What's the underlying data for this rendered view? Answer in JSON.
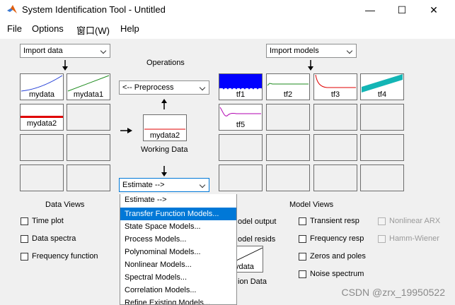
{
  "window": {
    "title": "System Identification Tool - Untitled",
    "minimize_glyph": "—",
    "maximize_glyph": "☐",
    "close_glyph": "✕"
  },
  "menu": [
    "File",
    "Options",
    "窗口(W)",
    "Help"
  ],
  "import_data": "Import data",
  "import_models": "Import models",
  "operations_label": "Operations",
  "preprocess": "<-- Preprocess",
  "working_data_name": "mydata2",
  "working_data_label": "Working Data",
  "estimate": "Estimate -->",
  "data_tiles": [
    {
      "label": "mydata",
      "icon": "curve-plot-icon",
      "color": "#1f3bd6"
    },
    {
      "label": "mydata1",
      "icon": "line-plot-icon",
      "color": "#1c8a1c"
    },
    {
      "label": "mydata2",
      "icon": "flat-red-line-icon",
      "color": "#e00000"
    }
  ],
  "model_tiles": [
    {
      "label": "tf1",
      "icon": "noisy-blue-plot-icon",
      "color": "#0000ff"
    },
    {
      "label": "tf2",
      "icon": "flat-green-plot-icon",
      "color": "#1c8a1c"
    },
    {
      "label": "tf3",
      "icon": "decay-red-plot-icon",
      "color": "#e00000"
    },
    {
      "label": "tf4",
      "icon": "cyan-band-plot-icon",
      "color": "#13b5b5"
    },
    {
      "label": "tf5",
      "icon": "damped-purple-plot-icon",
      "color": "#b000b0"
    }
  ],
  "data_views_label": "Data Views",
  "data_views": [
    "Time plot",
    "Data spectra",
    "Frequency function"
  ],
  "model_views_label": "Model Views",
  "model_views": [
    "Transient resp",
    "Frequency resp",
    "Zeros and poles",
    "Noise spectrum"
  ],
  "model_views_disabled": [
    "Nonlinear ARX",
    "Hamm-Wiener"
  ],
  "partial_checkbox_labels": [
    "odel output",
    "odel resids"
  ],
  "hidden_tile_text": [
    "ydata",
    "ion Data"
  ],
  "estimate_menu": {
    "highlighted_index": 0,
    "items": [
      "Transfer Function Models...",
      "State Space Models...",
      "Process Models...",
      "Polynominal Models...",
      "Nonlinear Models...",
      "Spectral Models...",
      "Correlation Models...",
      "Refine Existing Models..."
    ]
  },
  "watermark": "CSDN @zrx_19950522"
}
